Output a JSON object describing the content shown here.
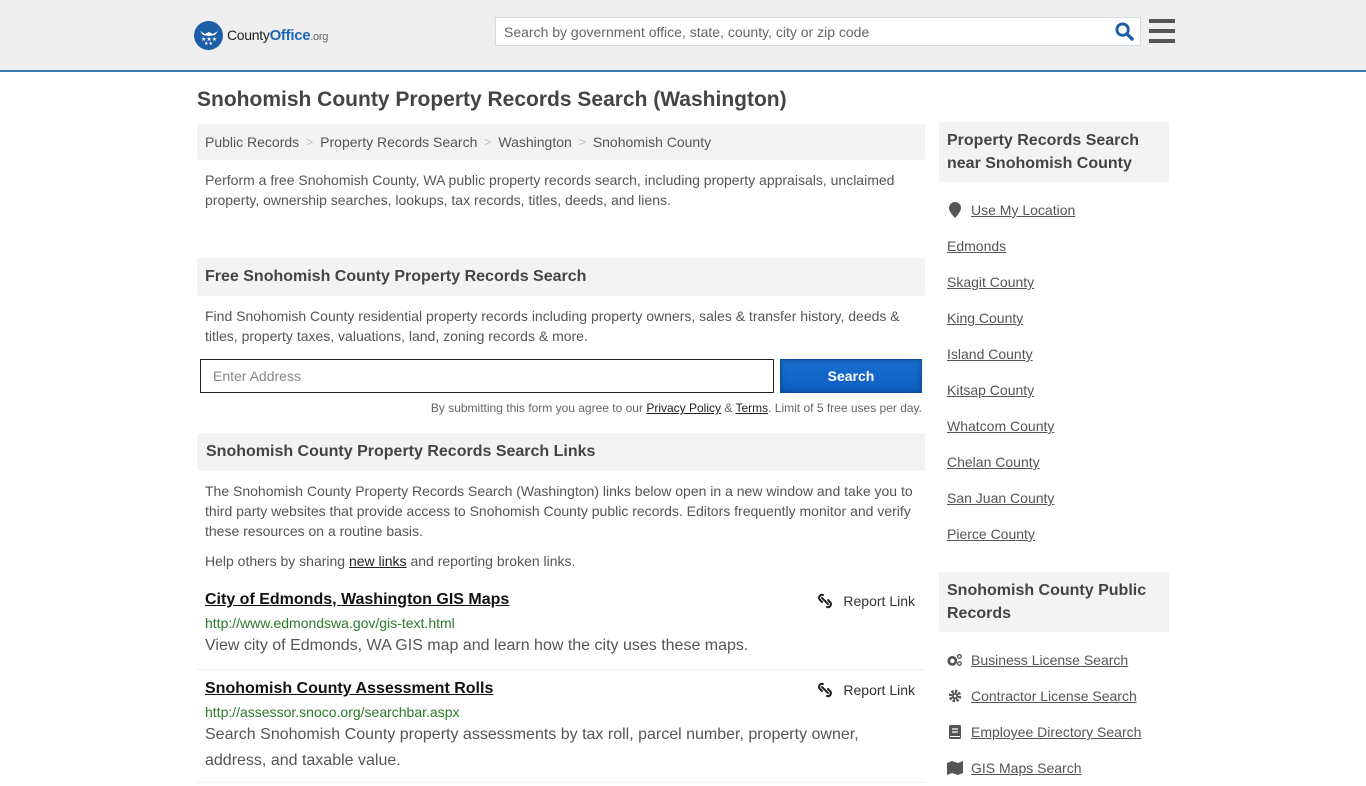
{
  "header": {
    "logo": {
      "county": "County",
      "office": "Office",
      "tld": ".org"
    },
    "search_placeholder": "Search by government office, state, county, city or zip code",
    "accent_color": "#3a7db4"
  },
  "page": {
    "title": "Snohomish County Property Records Search (Washington)",
    "breadcrumb": [
      "Public Records",
      "Property Records Search",
      "Washington",
      "Snohomish County"
    ],
    "breadcrumb_separator": ">",
    "intro": "Perform a free Snohomish County, WA public property records search, including property appraisals, unclaimed property, ownership searches, lookups, tax records, titles, deeds, and liens."
  },
  "search_section": {
    "heading": "Free Snohomish County Property Records Search",
    "description": "Find Snohomish County residential property records including property owners, sales & transfer history, deeds & titles, property taxes, valuations, land, zoning records & more.",
    "address_placeholder": "Enter Address",
    "button_label": "Search",
    "terms_prefix": "By submitting this form you agree to our ",
    "privacy_label": "Privacy Policy",
    "terms_amp": " & ",
    "terms_label": "Terms",
    "terms_suffix": ". Limit of 5 free uses per day."
  },
  "links_section": {
    "heading": "Snohomish County Property Records Search Links",
    "description": "The Snohomish County Property Records Search (Washington) links below open in a new window and take you to third party websites that provide access to Snohomish County public records. Editors frequently monitor and verify these resources on a routine basis.",
    "help_prefix": "Help others by sharing ",
    "help_link": "new links",
    "help_suffix": " and reporting broken links.",
    "report_label": "Report Link",
    "results": [
      {
        "title": "City of Edmonds, Washington GIS Maps",
        "url": "http://www.edmondswa.gov/gis-text.html",
        "description": "View city of Edmonds, WA GIS map and learn how the city uses these maps."
      },
      {
        "title": "Snohomish County Assessment Rolls",
        "url": "http://assessor.snoco.org/searchbar.aspx",
        "description": "Search Snohomish County property assessments by tax roll, parcel number, property owner, address, and taxable value."
      }
    ]
  },
  "sidebar": {
    "nearby_heading": "Property Records Search near Snohomish County",
    "use_location": "Use My Location",
    "nearby": [
      "Edmonds",
      "Skagit County",
      "King County",
      "Island County",
      "Kitsap County",
      "Whatcom County",
      "Chelan County",
      "San Juan County",
      "Pierce County"
    ],
    "public_heading": "Snohomish County Public Records",
    "public_records": [
      {
        "label": "Business License Search",
        "icon": "cogs-icon"
      },
      {
        "label": "Contractor License Search",
        "icon": "gear-icon"
      },
      {
        "label": "Employee Directory Search",
        "icon": "book-icon"
      },
      {
        "label": "GIS Maps Search",
        "icon": "map-icon"
      }
    ]
  }
}
